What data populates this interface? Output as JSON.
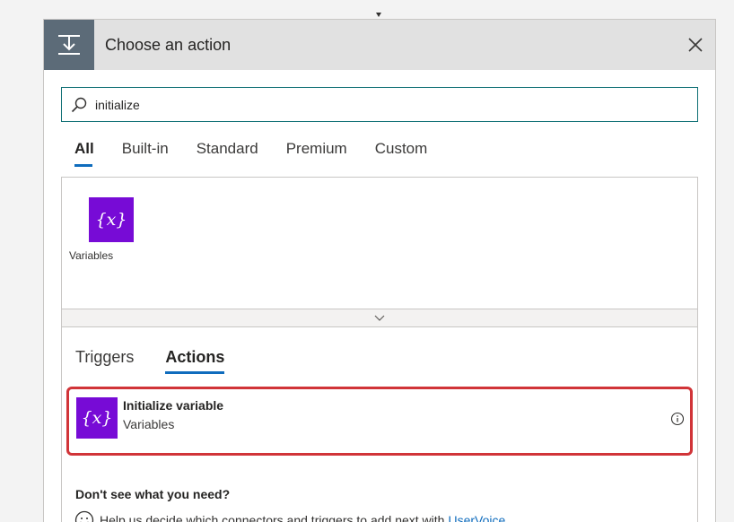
{
  "dialog": {
    "title": "Choose an action",
    "header_icon": "flow-step-icon",
    "close_icon": "close-icon"
  },
  "search": {
    "value": "initialize",
    "icon": "search-icon"
  },
  "tabs": [
    {
      "label": "All",
      "active": true
    },
    {
      "label": "Built-in",
      "active": false
    },
    {
      "label": "Standard",
      "active": false
    },
    {
      "label": "Premium",
      "active": false
    },
    {
      "label": "Custom",
      "active": false
    }
  ],
  "connectors": [
    {
      "label": "Variables",
      "icon": "variables-icon",
      "icon_text": "{x}",
      "color": "#770bd6"
    }
  ],
  "sub_tabs": [
    {
      "label": "Triggers",
      "active": false
    },
    {
      "label": "Actions",
      "active": true
    }
  ],
  "actions": [
    {
      "name": "Initialize variable",
      "connector": "Variables",
      "icon": "variables-icon",
      "icon_text": "{x}",
      "highlight_color": "#d13438"
    }
  ],
  "footer": {
    "prompt": "Don't see what you need?",
    "help_text": "Help us decide which connectors and triggers to add next with",
    "link_text": "UserVoice"
  },
  "colors": {
    "accent": "#0f6cbd",
    "variables": "#770bd6",
    "search_border": "#0e6f74"
  }
}
